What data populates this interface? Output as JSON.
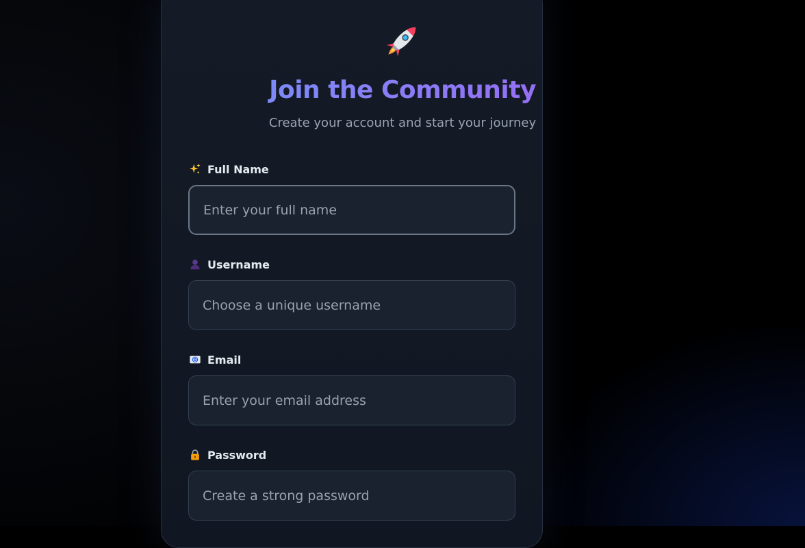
{
  "header": {
    "logo_icon": "rocket-icon",
    "title": "Join the Community",
    "subtitle": "Create your account and start your journey",
    "title_gradient": [
      "#60a5fa",
      "#a855f7"
    ]
  },
  "form": {
    "fields": [
      {
        "icon": "sparkles-icon",
        "label": "Full Name",
        "placeholder": "Enter your full name",
        "value": ""
      },
      {
        "icon": "user-silhouette-icon",
        "label": "Username",
        "placeholder": "Choose a unique username",
        "value": ""
      },
      {
        "icon": "email-icon",
        "label": "Email",
        "placeholder": "Enter your email address",
        "value": ""
      },
      {
        "icon": "lock-icon",
        "label": "Password",
        "placeholder": "Create a strong password",
        "value": ""
      }
    ]
  },
  "colors": {
    "background": "#000000",
    "card": "#141b26",
    "input_bg": "#1a2230",
    "input_border": "#333e4e"
  }
}
